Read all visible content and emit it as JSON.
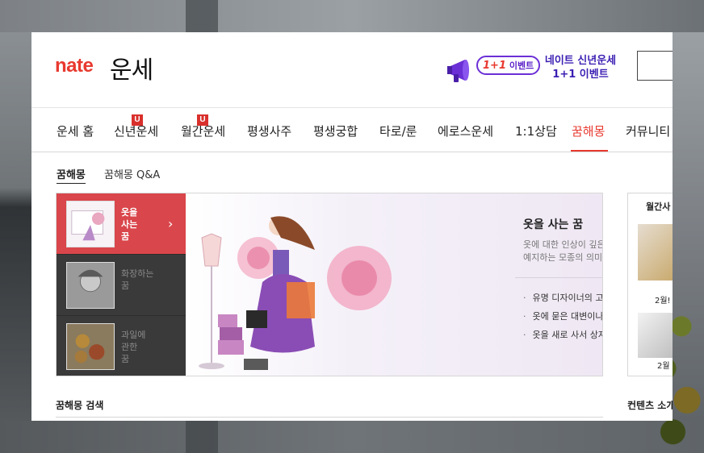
{
  "header": {
    "logo": "nate",
    "service": "운세",
    "promo": {
      "badge_number": "1+1",
      "badge_text": "이벤트",
      "line1": "네이트 신년운세",
      "line2": "1+1 이벤트"
    }
  },
  "gnb": {
    "items": [
      {
        "label": "운세 홈"
      },
      {
        "label": "신년운세",
        "badge": "U"
      },
      {
        "label": "월간운세",
        "badge": "U"
      },
      {
        "label": "평생사주"
      },
      {
        "label": "평생궁합"
      },
      {
        "label": "타로/룬"
      },
      {
        "label": "에로스운세"
      },
      {
        "label": "1:1상담"
      },
      {
        "label": "꿈해몽"
      },
      {
        "label": "커뮤니티"
      }
    ],
    "active": "꿈해몽"
  },
  "subnav": {
    "items": [
      "꿈해몽",
      "꿈해몽 Q&A"
    ]
  },
  "feature": {
    "tabs": [
      {
        "label": "옷을 사는 꿈",
        "lines": [
          "옷을",
          "사는",
          "꿈"
        ]
      },
      {
        "label": "화장하는 꿈",
        "lines": [
          "화장하는",
          "꿈"
        ]
      },
      {
        "label": "과일에 관한 꿈",
        "lines": [
          "과일에",
          "관한",
          "꿈"
        ]
      }
    ],
    "title": "옷을 사는 꿈",
    "description": "옷에 대한 인상이 깊은 것은 반드시 미래를 예지하는 모종의 의미입니다",
    "list": [
      "유명 디자이너의 고급 ...",
      "옷에 묻은 대변이나 소...",
      "옷을 새로 사서 상자에..."
    ]
  },
  "right_column": {
    "title": "월간사",
    "caption1": "2월!",
    "caption2": "2월"
  },
  "sections": {
    "search_title": "꿈해몽 검색",
    "contents_title": "컨텐츠 소개"
  },
  "colors": {
    "brand_red": "#e8392f",
    "promo_purple": "#3c1fb3",
    "tab_active": "#d9464b",
    "tab_inactive": "#3a3a3a"
  }
}
